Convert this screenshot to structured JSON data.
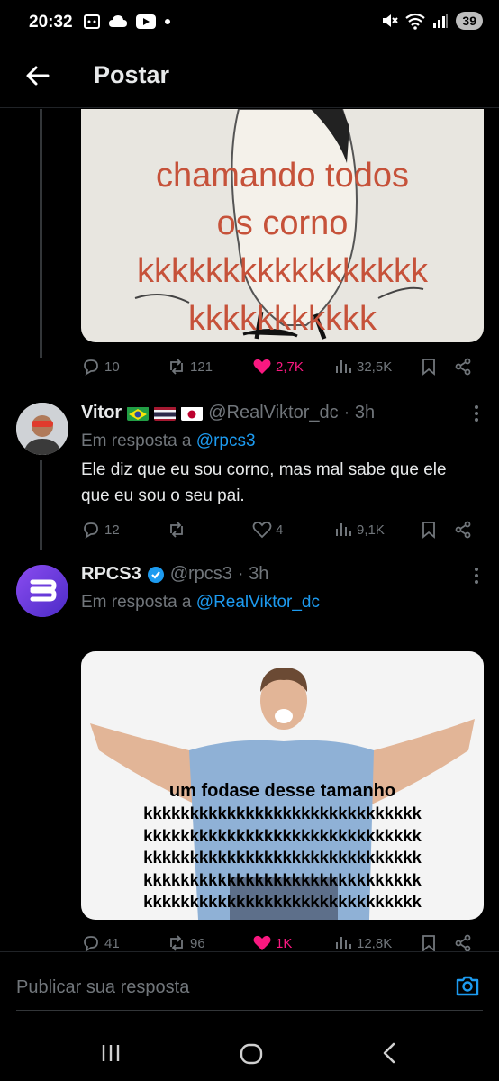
{
  "status_bar": {
    "time": "20:32",
    "battery": "39",
    "icons": [
      "screenshot-icon",
      "cloud-icon",
      "youtube-icon",
      "dot-icon",
      "mute-icon",
      "wifi-icon",
      "signal-icon"
    ]
  },
  "header": {
    "title": "Postar",
    "back_icon": "arrow-left-icon"
  },
  "tweets": [
    {
      "media_caption": [
        "chamando todos",
        "os corno",
        "kkkkkkkkkkkkkkkkk",
        "kkkkkkkkkkk"
      ],
      "actions": {
        "replies": "10",
        "reposts": "121",
        "likes": "2,7K",
        "views": "32,5K",
        "liked": true
      }
    },
    {
      "name": "Vitor",
      "flags": [
        "brazil-flag",
        "thailand-flag",
        "japan-flag"
      ],
      "handle": "@RealViktor_dc",
      "time": "· 3h",
      "reply_prefix": "Em resposta a",
      "reply_mention": "@rpcs3",
      "text": "Ele diz que eu sou corno, mas mal sabe que ele que eu sou o seu pai.",
      "actions": {
        "replies": "12",
        "reposts": "",
        "likes": "4",
        "views": "9,1K",
        "liked": false
      }
    },
    {
      "name": "RPCS3",
      "verified": true,
      "handle": "@rpcs3",
      "time": "· 3h",
      "reply_prefix": "Em resposta a",
      "reply_mention": "@RealViktor_dc",
      "media_caption": [
        "um fodase desse tamanho",
        "kkkkkkkkkkkkkkkkkkkkkkkkkkkkkk",
        "kkkkkkkkkkkkkkkkkkkkkkkkkkkkkk",
        "kkkkkkkkkkkkkkkkkkkkkkkkkkkkkk",
        "kkkkkkkkkkkkkkkkkkkkkkkkkkkkkk",
        "kkkkkkkkkkkkkkkkkkkkkkkkkkkkkk"
      ],
      "actions": {
        "replies": "41",
        "reposts": "96",
        "likes": "1K",
        "views": "12,8K",
        "liked": true
      }
    }
  ],
  "reply_bar": {
    "placeholder": "Publicar sua resposta",
    "camera_icon": "camera-icon"
  },
  "nav_bar": {
    "icons": [
      "recent-apps-icon",
      "home-icon",
      "back-icon"
    ]
  },
  "colors": {
    "background": "#000000",
    "accent": "#1d9bf0",
    "like": "#f91880",
    "muted": "#71767b",
    "text": "#e7e9ea"
  }
}
